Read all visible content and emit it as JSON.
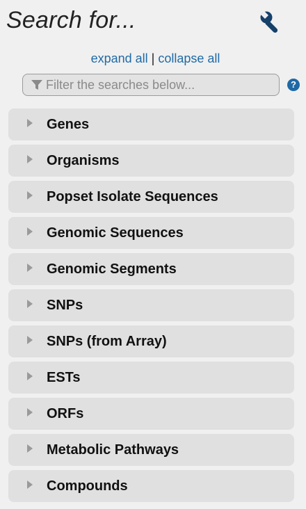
{
  "header": {
    "title": "Search for...",
    "tools_icon": "wrench-icon"
  },
  "links": {
    "expand_all": "expand all",
    "separator": "|",
    "collapse_all": "collapse all"
  },
  "filter": {
    "placeholder": "Filter the searches below...",
    "value": "",
    "icon": "filter-icon"
  },
  "help": {
    "label": "?",
    "icon": "help-icon"
  },
  "categories": [
    {
      "label": "Genes"
    },
    {
      "label": "Organisms"
    },
    {
      "label": "Popset Isolate Sequences"
    },
    {
      "label": "Genomic Sequences"
    },
    {
      "label": "Genomic Segments"
    },
    {
      "label": "SNPs"
    },
    {
      "label": "SNPs (from Array)"
    },
    {
      "label": "ESTs"
    },
    {
      "label": "ORFs"
    },
    {
      "label": "Metabolic Pathways"
    },
    {
      "label": "Compounds"
    }
  ],
  "colors": {
    "background": "#f0f0f0",
    "item_bg": "#e0e0e0",
    "link": "#1f6aa5",
    "help_bg": "#1f6aa5",
    "icon_dark": "#1a4a7a"
  }
}
